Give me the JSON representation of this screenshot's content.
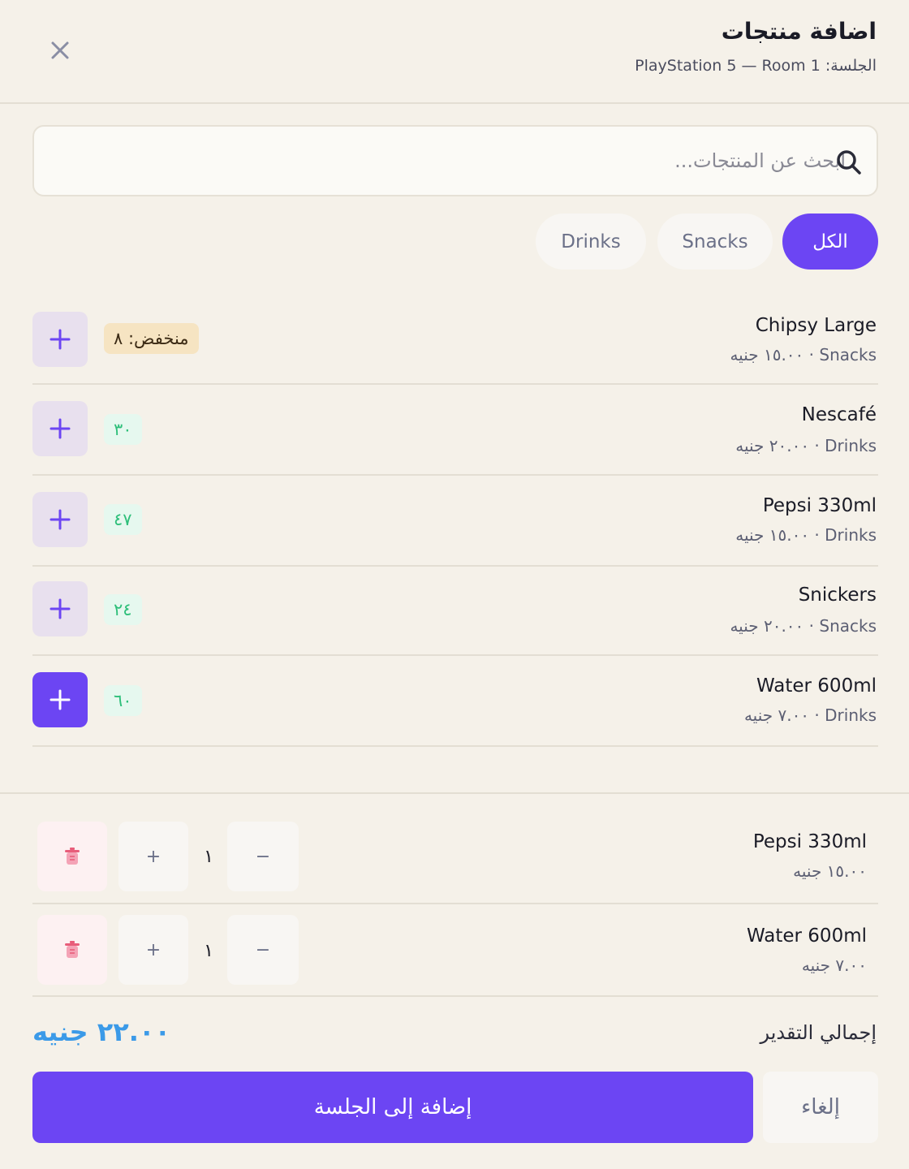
{
  "header": {
    "title": "اضافة منتجات",
    "subtitle": "الجلسة: PlayStation 5 — Room 1"
  },
  "search": {
    "placeholder": "ابحث عن المنتجات...",
    "value": ""
  },
  "filters": [
    {
      "label": "الكل",
      "active": true
    },
    {
      "label": "Snacks",
      "active": false
    },
    {
      "label": "Drinks",
      "active": false
    }
  ],
  "products": [
    {
      "name": "Chipsy Large",
      "meta": "Snacks · ١٥.٠٠ جنيه",
      "stock": "منخفض: ٨",
      "stock_status": "low"
    },
    {
      "name": "Nescafé",
      "meta": "Drinks · ٢٠.٠٠ جنيه",
      "stock": "٣٠",
      "stock_status": "ok"
    },
    {
      "name": "Pepsi 330ml",
      "meta": "Drinks · ١٥.٠٠ جنيه",
      "stock": "٤٧",
      "stock_status": "ok"
    },
    {
      "name": "Snickers",
      "meta": "Snacks · ٢٠.٠٠ جنيه",
      "stock": "٢٤",
      "stock_status": "ok"
    },
    {
      "name": "Water 600ml",
      "meta": "Drinks · ٧.٠٠ جنيه",
      "stock": "٦٠",
      "stock_status": "ok"
    }
  ],
  "cart": [
    {
      "name": "Pepsi 330ml",
      "price": "١٥.٠٠ جنيه",
      "qty": "١",
      "plus": "+",
      "minus": "−"
    },
    {
      "name": "Water 600ml",
      "price": "٧.٠٠ جنيه",
      "qty": "١",
      "plus": "+",
      "minus": "−"
    }
  ],
  "total": {
    "label": "إجمالي التقدير",
    "value": "٢٢.٠٠ جنيه"
  },
  "actions": {
    "submit": "إضافة إلى الجلسة",
    "cancel": "إلغاء"
  },
  "colors": {
    "accent": "#6c45f3",
    "background": "#f5f1e9",
    "total": "#3b9ae8",
    "stock_ok": "#2fbf7a",
    "stock_low_bg": "#f6e4c2",
    "danger": "#e85d7a"
  }
}
